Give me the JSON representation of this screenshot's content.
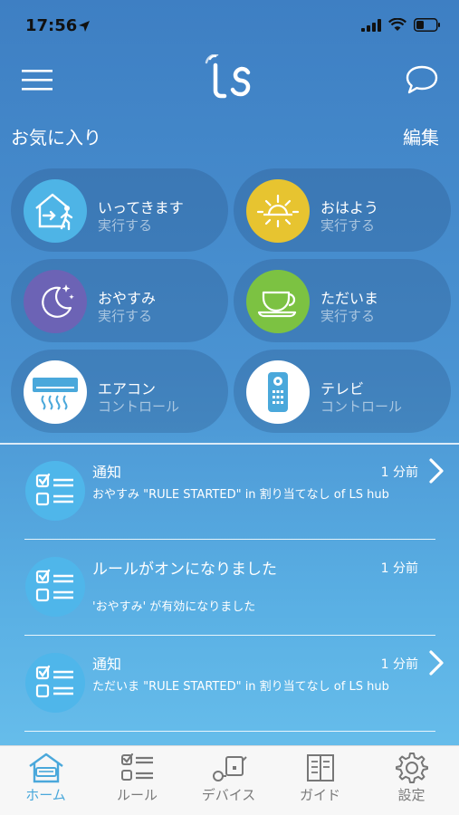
{
  "status_bar": {
    "time": "17:56"
  },
  "header": {
    "logo_text": "LS"
  },
  "favorites": {
    "title": "お気に入り",
    "edit_label": "編集",
    "items": [
      {
        "name": "いってきます",
        "action": "実行する",
        "icon": "leave-home-icon",
        "color": "#4eb4e6"
      },
      {
        "name": "おはよう",
        "action": "実行する",
        "icon": "sun-icon",
        "color": "#e7c430"
      },
      {
        "name": "おやすみ",
        "action": "実行する",
        "icon": "moon-icon",
        "color": "#6c63b5"
      },
      {
        "name": "ただいま",
        "action": "実行する",
        "icon": "teacup-icon",
        "color": "#7cc242"
      },
      {
        "name": "エアコン",
        "action": "コントロール",
        "icon": "air-conditioner-icon",
        "color": "#ffffff"
      },
      {
        "name": "テレビ",
        "action": "コントロール",
        "icon": "remote-icon",
        "color": "#ffffff"
      }
    ]
  },
  "notifications": [
    {
      "title": "通知",
      "time": "1 分前",
      "body": "おやすみ \"RULE STARTED\" in 割り当てなし of LS hub"
    },
    {
      "title": "ルールがオンになりました",
      "time": "1 分前",
      "body": "'おやすみ' が有効になりました"
    },
    {
      "title": "通知",
      "time": "1 分前",
      "body": "ただいま \"RULE STARTED\" in 割り当てなし of LS hub"
    }
  ],
  "tabs": [
    {
      "label": "ホーム",
      "icon": "home-icon"
    },
    {
      "label": "ルール",
      "icon": "rule-list-icon"
    },
    {
      "label": "デバイス",
      "icon": "devices-icon"
    },
    {
      "label": "ガイド",
      "icon": "guide-book-icon"
    },
    {
      "label": "設定",
      "icon": "gear-icon"
    }
  ],
  "colors": {
    "accent": "#4aa8db",
    "tab_inactive": "#7a7a7a"
  }
}
